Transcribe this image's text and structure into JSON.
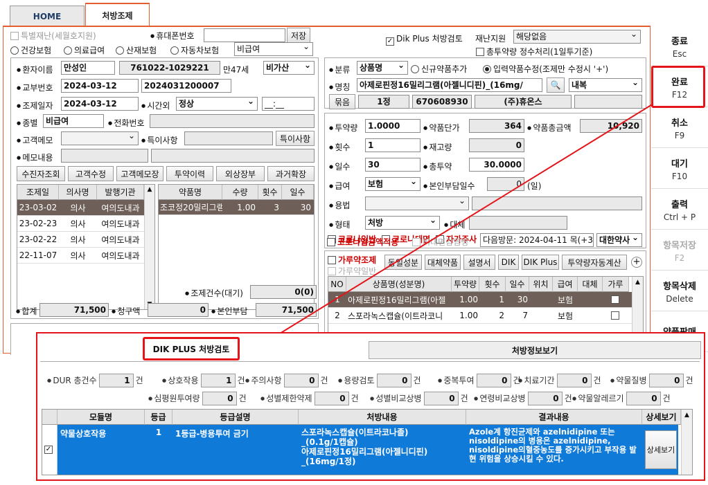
{
  "tabs": {
    "home": "HOME",
    "prescription": "처방조제"
  },
  "top": {
    "disaster_cb": "특별재난(세월호지원)",
    "phone_lbl": "휴대폰번호",
    "save_btn": "저장",
    "dik_cb": "Dik Plus 처방검토",
    "disaster_support_lbl": "재난지원",
    "disaster_support_val": "해당없음",
    "total_dose_cb": "총투약량 정수처리(1일투기준)",
    "ins_health": "건강보험",
    "ins_medical": "의료급여",
    "ins_industrial": "산재보험",
    "ins_auto": "자동차보험",
    "ins_select": "비급여"
  },
  "patient": {
    "name_lbl": "환자이름",
    "name": "만성인",
    "rrn": "761022-1029221",
    "age": "만47세",
    "tax": "비가산",
    "issue_lbl": "교부번호",
    "issue_date": "2024-03-12",
    "issue_no": "2024031200007",
    "dispense_lbl": "조제일자",
    "dispense_date": "2024-03-12",
    "time_lbl": "시간외",
    "time_val": "정상",
    "time_input": "__:__",
    "type_lbl": "종별",
    "type_val": "비급여",
    "tel_lbl": "전화번호",
    "memo_lbl": "고객메모",
    "special_lbl": "특이사항",
    "special_btn": "특이사항",
    "memo2_lbl": "메모내용"
  },
  "patient_buttons": [
    "수진자조회",
    "고객수정",
    "고객메모장",
    "투약이력",
    "외상장부",
    "과거확장"
  ],
  "history": {
    "headers": [
      "조제일",
      "의사명",
      "발행기관"
    ],
    "rows": [
      [
        "23-03-02",
        "의사",
        "여의도내과"
      ],
      [
        "23-02-23",
        "의사",
        "여의도내과"
      ],
      [
        "23-02-22",
        "의사",
        "여의도내과"
      ],
      [
        "22-11-07",
        "의사",
        "여의도내과"
      ]
    ]
  },
  "history_drugs": {
    "headers": [
      "약품명",
      "수량",
      "횟수",
      "일수"
    ],
    "rows": [
      [
        "조코정20밀리그램",
        "1.00",
        "3",
        "30"
      ]
    ]
  },
  "counts": {
    "cases_lbl": "조제건수(대기)",
    "cases_val": "0(0)",
    "total_lbl": "합계",
    "total_val": "71,500",
    "claim_lbl": "청구액",
    "claim_val": "0",
    "self_lbl": "본인부담",
    "self_val": "71,500"
  },
  "drug": {
    "class_lbl": "분류",
    "class_val": "상품명",
    "new_drug": "신규약품추가",
    "edit_drug": "입력약품수정(조제만 수정시 '+')",
    "name_lbl": "명칭",
    "name_val": "아제로핀정16밀리그램(아젤니디핀)_(16mg/",
    "route": "내복",
    "group_btn": "묶음",
    "unit": "1정",
    "code": "670608930",
    "maker": "(주)휴온스",
    "dose_lbl": "투약량",
    "dose_val": "1.0000",
    "price_lbl": "약품단가",
    "price_val": "364",
    "sum_lbl": "약품총금액",
    "sum_val": "10,920",
    "times_lbl": "횟수",
    "times_val": "1",
    "stock_lbl": "재고량",
    "stock_val": "0",
    "days_lbl": "일수",
    "days_val": "30",
    "total_lbl": "총투약",
    "total_val": "30.0000",
    "pay_lbl": "급여",
    "pay_val": "보험",
    "selfdays_lbl": "본인부담일수",
    "selfdays_val": "0",
    "selfdays_unit": "(일)",
    "usage_lbl": "용법",
    "form_lbl": "형태",
    "form_val": "처방",
    "sub_lbl": "대체",
    "covid1": "코로나일반",
    "covid2": "코로나대면",
    "covid3": "자가주사",
    "covid4": "코로나입금액적용",
    "covid5": "비대면감염병",
    "next_visit": "다음방문: 2024-04-11 목(+30",
    "pharmacy": "대한약사"
  },
  "rx_toolbar": {
    "powder": "가루약조제",
    "powder_gen": "가루약일반",
    "buttons": [
      "동일성분",
      "대체약품",
      "설명서",
      "DIK",
      "DIK Plus",
      "투약량자동계산"
    ]
  },
  "rx_table": {
    "headers": [
      "NO",
      "상품명(성분명)",
      "투약량",
      "횟수",
      "일수",
      "위치",
      "급여",
      "대체",
      "가루"
    ],
    "rows": [
      [
        "1",
        "아제로핀정16밀리그램(아젤",
        "1.00",
        "1",
        "30",
        "",
        "보험",
        ""
      ],
      [
        "2",
        "스포라녹스캡슐(이트라코니",
        "1.00",
        "2",
        "7",
        "",
        "보험",
        ""
      ]
    ]
  },
  "right_buttons": [
    {
      "t": "종료",
      "k": "Esc"
    },
    {
      "t": "완료",
      "k": "F12"
    },
    {
      "t": "취소",
      "k": "F9"
    },
    {
      "t": "대기",
      "k": "F10"
    },
    {
      "t": "출력",
      "k": "Ctrl + P"
    },
    {
      "t": "항목저장",
      "k": "F2"
    },
    {
      "t": "항목삭제",
      "k": "Delete"
    },
    {
      "t": "약품판매",
      "k": ""
    }
  ],
  "dik": {
    "tab1": "DIK PLUS 처방검토",
    "tab2": "처방정보보기",
    "unit": "건",
    "counts_row1": [
      {
        "l": "DUR 총건수",
        "v": "1"
      },
      {
        "l": "상호작용",
        "v": "1"
      },
      {
        "l": "주의사항",
        "v": "0"
      },
      {
        "l": "용량검토",
        "v": "0"
      },
      {
        "l": "중복투여",
        "v": "0"
      },
      {
        "l": "치료기간",
        "v": "0"
      },
      {
        "l": "약물질병",
        "v": "0"
      }
    ],
    "counts_row2": [
      {
        "l": "심평원투여량",
        "v": "0"
      },
      {
        "l": "성별제한약제",
        "v": "0"
      },
      {
        "l": "성별비교상병",
        "v": "0"
      },
      {
        "l": "연령비교상병",
        "v": "0"
      },
      {
        "l": "약물알레르기",
        "v": "0"
      }
    ],
    "headers": [
      "모듈명",
      "등급",
      "등급설명",
      "처방내용",
      "결과내용",
      "상세보기"
    ],
    "row": {
      "module": "약물상호작용",
      "grade": "1",
      "grade_desc": "1등급-병용투여 금기",
      "rx1": "스포라녹스캡슐(이트라코나졸)",
      "rx2": "_(0.1g/1캡슐)",
      "rx3": "아제로핀정16밀리그램(아젤니디핀)",
      "rx4": "_(16mg/1정)",
      "result": "Azole계 항진균제와 azelnidipine 또는 nisoldipine의 병용은 azelnidipine, nisoldipine의혈중농도를 증가시키고 부작용 발현 위험을 상승시킬 수 있다.",
      "detail_btn": "상세보기"
    }
  }
}
